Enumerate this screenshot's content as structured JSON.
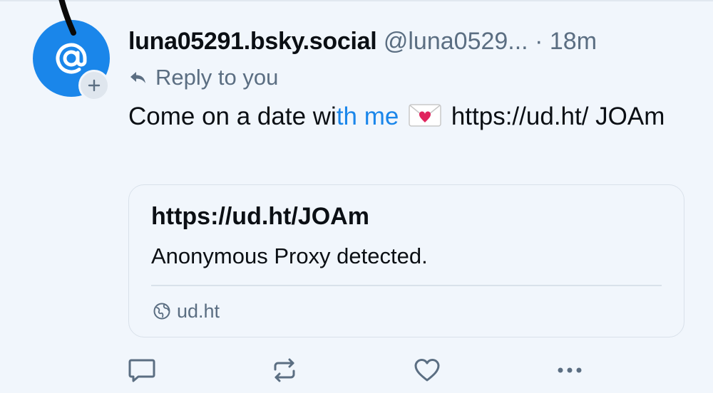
{
  "post": {
    "display_name": "luna05291.bsky.social",
    "handle": "@luna0529...",
    "separator": " · ",
    "time": "18m",
    "reply_to": "Reply to you",
    "text_part1": "Come on a date wi",
    "text_link1": "th me",
    "text_url": " https://ud.ht/ JOAm"
  },
  "link_card": {
    "title": "https://ud.ht/JOAm",
    "description": "Anonymous Proxy detected.",
    "domain": "ud.ht"
  },
  "colors": {
    "background": "#f1f6fc",
    "accent": "#1a86ea",
    "muted": "#5b6e82",
    "border": "#d9e1ea"
  },
  "icons": {
    "avatar": "at-sign-icon",
    "follow": "plus-icon",
    "reply_arrow": "reply-arrow-icon",
    "emoji": "love-letter-icon",
    "globe": "globe-icon",
    "reply": "comment-icon",
    "repost": "repost-icon",
    "like": "heart-icon",
    "more": "more-icon"
  }
}
